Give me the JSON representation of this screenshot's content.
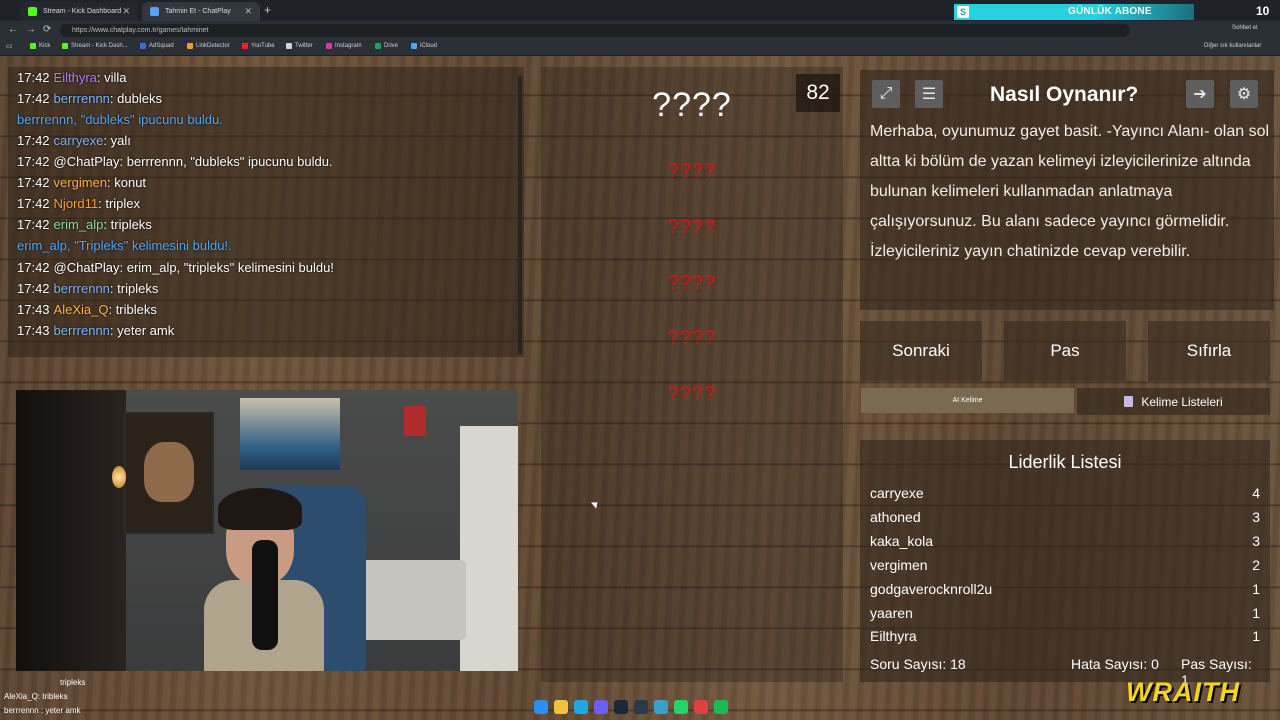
{
  "browser": {
    "tabs": [
      {
        "label": "Stream - Kick Dashboard",
        "icon": "kick-icon",
        "color": "#53fc18"
      },
      {
        "label": "Tahmin Et - ChatPlay",
        "icon": "chatplay-icon",
        "color": "#5aa0ff"
      }
    ],
    "url": "https://www.chatplay.com.tr/games/tahminet",
    "chat_ext_label": "Sohbet et",
    "bookmarks": [
      {
        "label": "Kick",
        "color": "#53fc18"
      },
      {
        "label": "Stream - Kick Dash...",
        "color": "#53fc18"
      },
      {
        "label": "AdSquad",
        "color": "#3d6be0"
      },
      {
        "label": "LinkDetector",
        "color": "#f0a020"
      },
      {
        "label": "YouTube",
        "color": "#ff2020"
      },
      {
        "label": "Twitter",
        "color": "#cfd3d8"
      },
      {
        "label": "Instagram",
        "color": "#d63aa0"
      },
      {
        "label": "Drive",
        "color": "#20a060"
      },
      {
        "label": "iCloud",
        "color": "#4aa8ff"
      }
    ],
    "other_bookmarks": "Diğer sık kullanılanlar"
  },
  "subscriber_banner": {
    "badge": "S",
    "label": "GÜNLÜK ABONE",
    "count": "10"
  },
  "chat": {
    "messages": [
      {
        "time": "17:42",
        "user": "Eilthyra",
        "user_color": "#b47bff",
        "text": ": villa"
      },
      {
        "time": "17:42",
        "user": "berrrennn",
        "user_color": "#7fb2ff",
        "text": ": dubleks"
      },
      {
        "system": "berrrennn, \"dubleks\" ipucunu buldu."
      },
      {
        "time": "17:42",
        "user": "carryexe",
        "user_color": "#7fb2ff",
        "text": ": yalı"
      },
      {
        "time": "17:42",
        "user": "@ChatPlay",
        "user_color": "#ffffff",
        "text": ": berrrennn, \"dubleks\" ipucunu buldu."
      },
      {
        "time": "17:42",
        "user": "vergimen",
        "user_color": "#ffb347",
        "text": ": konut"
      },
      {
        "time": "17:42",
        "user": "Njord11",
        "user_color": "#ff9f3a",
        "text": ": triplex"
      },
      {
        "time": "17:42",
        "user": "erim_alp",
        "user_color": "#7fe0a0",
        "text": ": tripleks"
      },
      {
        "system": "erim_alp, \"Tripleks\" kelimesini buldu!."
      },
      {
        "time": "17:42",
        "user": "@ChatPlay",
        "user_color": "#ffffff",
        "text": ": erim_alp, \"tripleks\" kelimesini buldu!"
      },
      {
        "time": "17:42",
        "user": "berrrennn",
        "user_color": "#7fb2ff",
        "text": ": tripleks"
      },
      {
        "time": "17:43",
        "user": "AleXia_Q",
        "user_color": "#ffb347",
        "text": ": tribleks"
      },
      {
        "time": "17:43",
        "user": "berrrennn",
        "user_color": "#7fb2ff",
        "text": ": yeter amk"
      }
    ]
  },
  "game": {
    "hidden_word": "????",
    "timer": "82",
    "hidden_slots": [
      "????",
      "????",
      "????",
      "????",
      "????"
    ]
  },
  "how_to": {
    "title": "Nasıl Oynanır?",
    "text": "Merhaba, oyunumuz gayet basit. -Yayıncı Alanı- olan sol altta ki bölüm de yazan kelimeyi izleyicilerinize altında bulunan kelimeleri kullanmadan anlatmaya çalışıyorsunuz. Bu alanı sadece yayıncı görmelidir. İzleyicileriniz yayın chatinizde cevap verebilir."
  },
  "actions": {
    "next": "Sonraki",
    "pass": "Pas",
    "reset": "Sıfırla",
    "ai_word": "AI Kelime",
    "word_lists": "Kelime Listeleri"
  },
  "leaderboard": {
    "title": "Liderlik Listesi",
    "rows": [
      {
        "name": "carryexe",
        "score": "4"
      },
      {
        "name": "athoned",
        "score": "3"
      },
      {
        "name": "kaka_kola",
        "score": "3"
      },
      {
        "name": "vergimen",
        "score": "2"
      },
      {
        "name": "godgaverocknroll2u",
        "score": "1"
      },
      {
        "name": "yaaren",
        "score": "1"
      },
      {
        "name": "Eilthyra",
        "score": "1"
      }
    ],
    "question_count": "Soru Sayısı: 18",
    "error_count": "Hata Sayısı: 0",
    "pass_count": "Pas Sayısı: 1"
  },
  "overlay_chat": {
    "lines": [
      "tripleks",
      "AleXia_Q: tribleks",
      "berrrennn : yeter amk"
    ]
  },
  "brand": "WRAITH",
  "colors": {
    "accent_red": "#d21818",
    "system_blue": "#4da9ff",
    "brand_yellow": "#f5d51a"
  }
}
